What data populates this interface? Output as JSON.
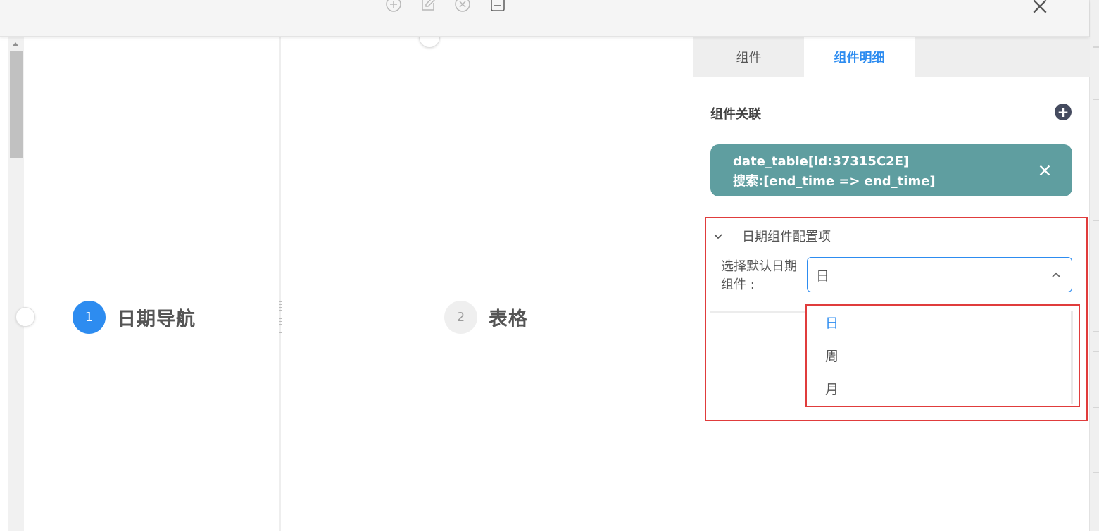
{
  "toolbar": {
    "icons": [
      "add-circle-icon",
      "edit-icon",
      "close-circle-icon",
      "save-icon"
    ],
    "close_icon": "close-icon"
  },
  "canvas": {
    "steps": [
      {
        "number": "1",
        "title": "日期导航",
        "state": "active"
      },
      {
        "number": "2",
        "title": "表格",
        "state": "idle"
      }
    ]
  },
  "panel": {
    "tabs": [
      {
        "label": "组件",
        "active": false
      },
      {
        "label": "组件明细",
        "active": true
      }
    ],
    "relation": {
      "title": "组件关联",
      "card_line1": "date_table[id:37315C2E]",
      "card_line2": "搜索:[end_time => end_time]"
    },
    "date_config": {
      "header": "日期组件配置项",
      "label": "选择默认日期组件 :",
      "selected": "日",
      "options": [
        "日",
        "周",
        "月"
      ]
    }
  },
  "colors": {
    "accent": "#2d8cf0",
    "card": "#5f9ea0",
    "highlight_border": "#e03c3c"
  }
}
